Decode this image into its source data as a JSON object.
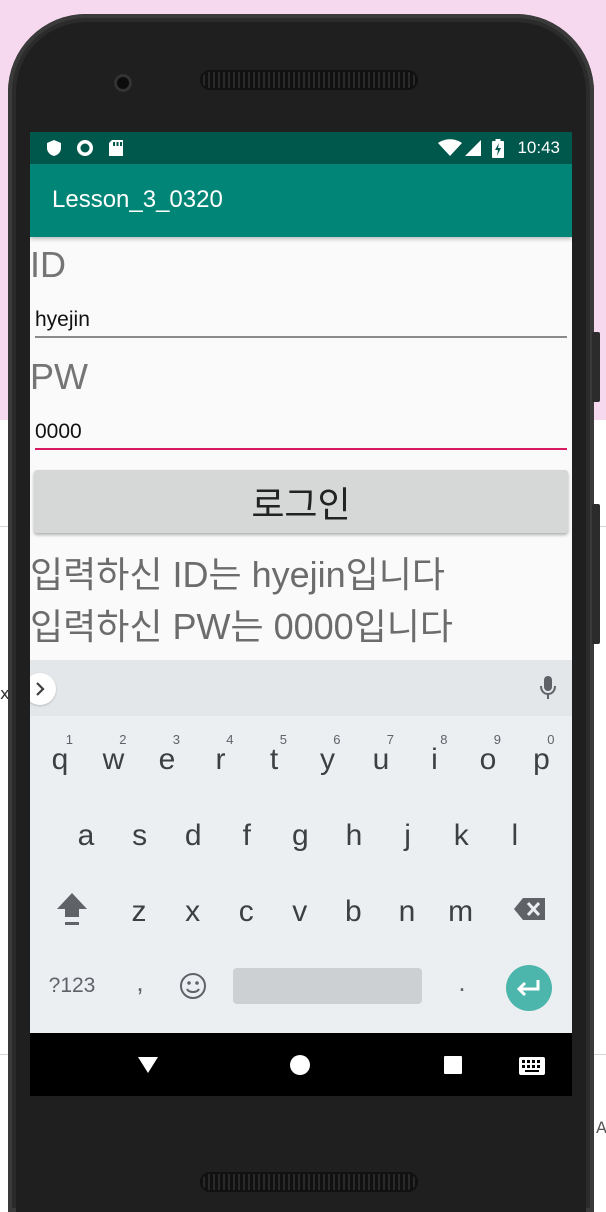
{
  "status_bar": {
    "time": "10:43",
    "left_icons": [
      "shield-icon",
      "circle-icon",
      "sdcard-icon"
    ],
    "right_icons": [
      "wifi-icon",
      "signal-icon",
      "battery-charging-icon"
    ]
  },
  "app_bar": {
    "title": "Lesson_3_0320"
  },
  "form": {
    "id_label": "ID",
    "id_value": "hyejin",
    "pw_label": "PW",
    "pw_value": "0000",
    "login_button": "로그인"
  },
  "results": {
    "id_line": "입력하신 ID는 hyejin입니다",
    "pw_line": "입력하신 PW는 0000입니다"
  },
  "keyboard": {
    "row1": [
      {
        "k": "q",
        "h": "1"
      },
      {
        "k": "w",
        "h": "2"
      },
      {
        "k": "e",
        "h": "3"
      },
      {
        "k": "r",
        "h": "4"
      },
      {
        "k": "t",
        "h": "5"
      },
      {
        "k": "y",
        "h": "6"
      },
      {
        "k": "u",
        "h": "7"
      },
      {
        "k": "i",
        "h": "8"
      },
      {
        "k": "o",
        "h": "9"
      },
      {
        "k": "p",
        "h": "0"
      }
    ],
    "row2": [
      "a",
      "s",
      "d",
      "f",
      "g",
      "h",
      "j",
      "k",
      "l"
    ],
    "row3": [
      "z",
      "x",
      "c",
      "v",
      "b",
      "n",
      "m"
    ],
    "symbols_key": "?123",
    "comma_key": ",",
    "period_key": "."
  },
  "colors": {
    "status_bar": "#00574b",
    "app_bar": "#008577",
    "accent": "#d81b60",
    "enter_key": "#4db6ac"
  }
}
